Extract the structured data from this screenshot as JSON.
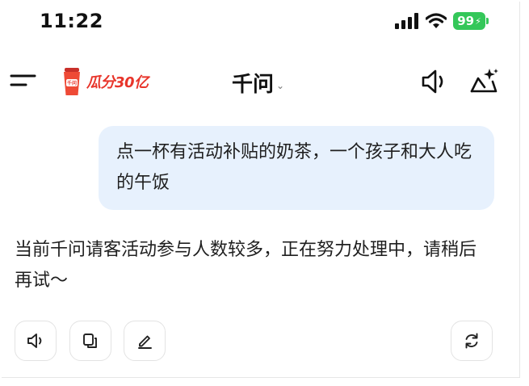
{
  "status_bar": {
    "time": "11:22",
    "battery": "99"
  },
  "nav": {
    "promo_text": "瓜分30亿",
    "promo_cup_text": "千问",
    "title": "千问",
    "chevron": "⌄"
  },
  "chat": {
    "user_message": "点一杯有活动补贴的奶茶，一个孩子和大人吃的午饭",
    "assistant_reply": "当前千问请客活动参与人数较多，正在努力处理中，请稍后再试～"
  },
  "icons": {
    "menu": "menu-icon",
    "speaker": "speaker-icon",
    "new_chat": "sparkle-chat-icon",
    "copy": "copy-icon",
    "edit": "edit-icon",
    "regenerate": "refresh-icon"
  },
  "colors": {
    "accent_red": "#e8352b",
    "user_bubble": "#e7f1fd",
    "battery": "#34c759"
  }
}
